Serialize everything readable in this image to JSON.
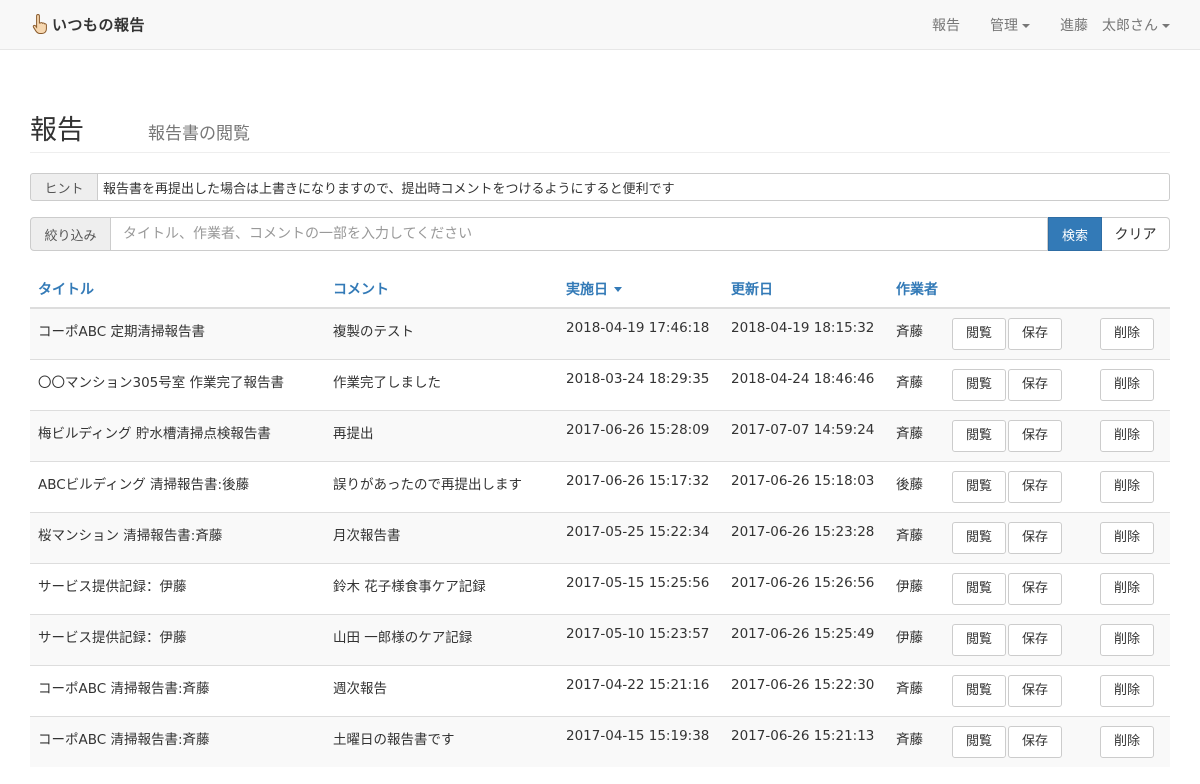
{
  "navbar": {
    "brand": "いつもの報告",
    "links": [
      {
        "label": "報告"
      },
      {
        "label": "管理"
      },
      {
        "label": "進藤"
      },
      {
        "label": "太郎さん"
      }
    ]
  },
  "header": {
    "title": "報告",
    "subtitle": "報告書の閲覧"
  },
  "hint": {
    "label": "ヒント",
    "text": "報告書を再提出した場合は上書きになりますので、提出時コメントをつけるようにすると便利です"
  },
  "filter": {
    "label": "絞り込み",
    "placeholder": "タイトル、作業者、コメントの一部を入力してください",
    "search_label": "検索",
    "clear_label": "クリア"
  },
  "table": {
    "columns": [
      "タイトル",
      "コメント",
      "実施日",
      "更新日",
      "作業者"
    ],
    "actions": {
      "view": "閲覧",
      "save": "保存",
      "delete": "削除"
    },
    "rows": [
      {
        "title": "コーポABC 定期清掃報告書",
        "comment": "複製のテスト",
        "date": "2018-04-19 17:46:18",
        "updated": "2018-04-19 18:15:32",
        "worker": "斉藤"
      },
      {
        "title": "〇〇マンション305号室 作業完了報告書",
        "comment": "作業完了しました",
        "date": "2018-03-24 18:29:35",
        "updated": "2018-04-24 18:46:46",
        "worker": "斉藤"
      },
      {
        "title": "梅ビルディング 貯水槽清掃点検報告書",
        "comment": "再提出",
        "date": "2017-06-26 15:28:09",
        "updated": "2017-07-07 14:59:24",
        "worker": "斉藤"
      },
      {
        "title": "ABCビルディング 清掃報告書:後藤",
        "comment": "誤りがあったので再提出します",
        "date": "2017-06-26 15:17:32",
        "updated": "2017-06-26 15:18:03",
        "worker": "後藤"
      },
      {
        "title": "桜マンション 清掃報告書:斉藤",
        "comment": "月次報告書",
        "date": "2017-05-25 15:22:34",
        "updated": "2017-06-26 15:23:28",
        "worker": "斉藤"
      },
      {
        "title": "サービス提供記録：伊藤",
        "comment": "鈴木 花子様食事ケア記録",
        "date": "2017-05-15 15:25:56",
        "updated": "2017-06-26 15:26:56",
        "worker": "伊藤"
      },
      {
        "title": "サービス提供記録：伊藤",
        "comment": "山田 一郎様のケア記録",
        "date": "2017-05-10 15:23:57",
        "updated": "2017-06-26 15:25:49",
        "worker": "伊藤"
      },
      {
        "title": "コーポABC 清掃報告書:斉藤",
        "comment": "週次報告",
        "date": "2017-04-22 15:21:16",
        "updated": "2017-06-26 15:22:30",
        "worker": "斉藤"
      },
      {
        "title": "コーポABC 清掃報告書:斉藤",
        "comment": "土曜日の報告書です",
        "date": "2017-04-15 15:19:38",
        "updated": "2017-06-26 15:21:13",
        "worker": "斉藤"
      }
    ]
  }
}
